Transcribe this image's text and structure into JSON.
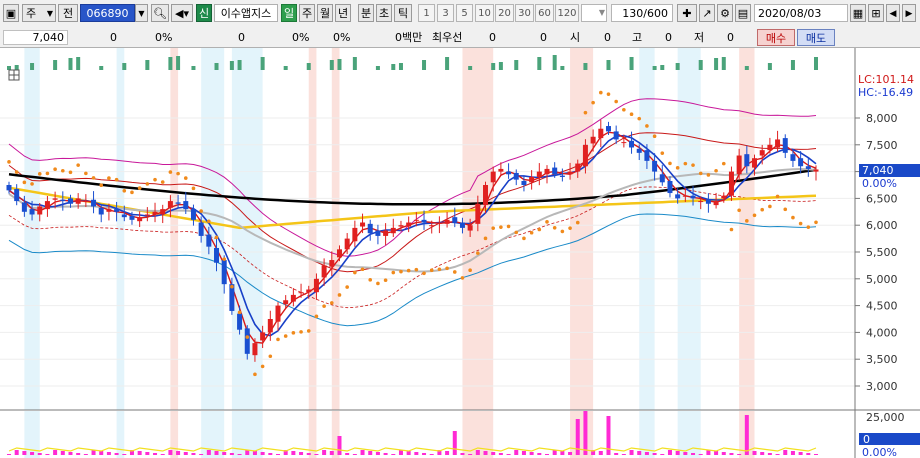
{
  "toolbar": {
    "market_select": "주",
    "type_select": "전",
    "code_value": "066890",
    "trade_badge": "신",
    "stock_name": "이수앱지스",
    "period_tabs": [
      "일",
      "주",
      "월",
      "년",
      "분",
      "초",
      "틱"
    ],
    "interval_buttons": [
      "1",
      "3",
      "5",
      "10",
      "20",
      "30",
      "60",
      "120"
    ],
    "count_display": "130/600",
    "date_value": "2020/08/03"
  },
  "quote": {
    "price": "7,040",
    "change": "0",
    "change_rate": "0%",
    "volume": "0",
    "volume_rate": "0%",
    "rate2": "0%",
    "amount": "0백만",
    "order_label": "최우선",
    "order_qty": "0",
    "order_val": "0",
    "open_label": "시",
    "open_val": "0",
    "high_label": "고",
    "high_val": "0",
    "low_label": "저",
    "low_val": "0",
    "buy_button": "매수",
    "sell_button": "매도"
  },
  "chart_data": {
    "type": "candlestick",
    "ylim": [
      2700,
      8700
    ],
    "y_ticks": [
      "8,000",
      "7,500",
      "7,000",
      "6,500",
      "6,000",
      "5,500",
      "5,000",
      "4,500",
      "4,000",
      "3,500",
      "3,000"
    ],
    "lc_label": "LC:101.14",
    "hc_label": "HC:-16.49",
    "last_price_label": "7,040",
    "last_pct_label": "0.00%",
    "volume_tick": "25,000",
    "volume_last_label": "0",
    "volume_pct_label": "0.00%",
    "closes": [
      6650,
      6450,
      6250,
      6200,
      6350,
      6450,
      6500,
      6450,
      6400,
      6500,
      6450,
      6350,
      6200,
      6300,
      6250,
      6150,
      6100,
      6150,
      6200,
      6250,
      6300,
      6450,
      6400,
      6300,
      6100,
      5800,
      5600,
      5300,
      4900,
      4400,
      4050,
      3600,
      3800,
      4000,
      4250,
      4500,
      4600,
      4700,
      4750,
      4800,
      5000,
      5250,
      5350,
      5550,
      5750,
      5950,
      6050,
      5850,
      5800,
      5900,
      5950,
      6000,
      6050,
      6100,
      6050,
      6000,
      6050,
      6100,
      6050,
      5950,
      6000,
      6400,
      6750,
      7000,
      7050,
      6950,
      6850,
      6750,
      6900,
      7000,
      7050,
      6950,
      6900,
      7000,
      7150,
      7500,
      7650,
      7800,
      7750,
      7600,
      7550,
      7450,
      7350,
      7200,
      7000,
      6800,
      6600,
      6500,
      6550,
      6500,
      6450,
      6400,
      6450,
      6550,
      7000,
      7300,
      7100,
      7250,
      7400,
      7500,
      7600,
      7350,
      7200,
      7100,
      7050,
      7040
    ],
    "colors": {
      "up": "#e02020",
      "down": "#1a4fd0",
      "ma_black": "#000000",
      "ma_yellow": "#f4c518",
      "ma_gray": "#b8b8b8",
      "parabolic": "#f08a1c",
      "volume_bar": "#ff2ad4",
      "volume_ma": "#f2e020"
    }
  }
}
